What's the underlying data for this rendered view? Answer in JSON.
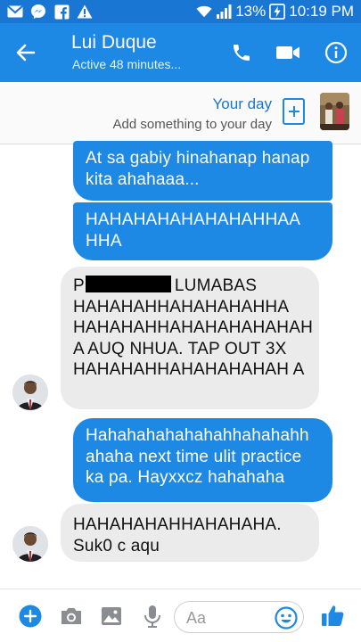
{
  "status_bar": {
    "battery": "13%",
    "time": "10:19 PM",
    "icons": [
      "gmail-icon",
      "messenger-icon",
      "facebook-icon",
      "warning-icon",
      "wifi-icon",
      "signal-icon",
      "battery-icon"
    ]
  },
  "header": {
    "title": "Lui Duque",
    "subtitle": "Active 48 minutes...",
    "actions": [
      "back-arrow-icon",
      "phone-icon",
      "video-camera-icon",
      "info-icon"
    ]
  },
  "your_day": {
    "title": "Your day",
    "subtitle": "Add something to your day",
    "add_icon": "plus"
  },
  "messages": [
    {
      "from": "me",
      "text": "At sa gabiy hinahanap hanap kita ahahaaa..."
    },
    {
      "from": "me",
      "text": "HAHAHAHAHAHAHAHHAA HHA"
    },
    {
      "from": "them",
      "text_before": "P",
      "text_after": "LUMABAS HAHAHAHHAHAHAHAHHA HAHAHAHHAHAHAHAHAHAH A AUQ NHUA. TAP OUT 3X HAHAHAHHAHAHAHAHAH A"
    },
    {
      "from": "me",
      "text": "Hahahahahahahahhahahahh ahaha next time ulit practice ka pa. Hayxxcz hahahaha"
    },
    {
      "from": "them",
      "text": "HAHAHAHAHHAHAHAHA. Suk0 c aqu"
    }
  ],
  "composer": {
    "placeholder": "Aa",
    "icons": [
      "plus-icon",
      "camera-icon",
      "gallery-icon",
      "microphone-icon",
      "emoji-icon",
      "thumbs-up-icon"
    ]
  },
  "colors": {
    "accent": "#1e88e5",
    "status_bar": "#1976d2",
    "received_bubble": "#ebebeb"
  }
}
